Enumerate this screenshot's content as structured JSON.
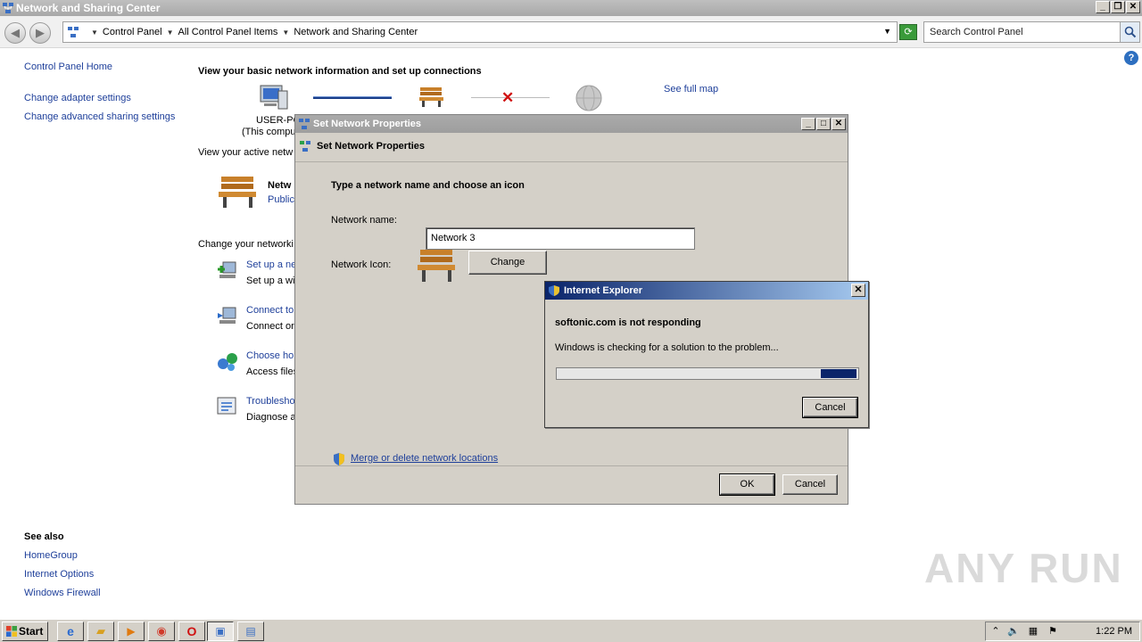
{
  "window": {
    "title": "Network and Sharing Center"
  },
  "addressbar": {
    "crumbs": [
      "Control Panel",
      "All Control Panel Items",
      "Network and Sharing Center"
    ],
    "search_placeholder": "Search Control Panel"
  },
  "sidebar": {
    "links": [
      "Control Panel Home",
      "Change adapter settings",
      "Change advanced sharing settings"
    ],
    "see_also_title": "See also",
    "see_also": [
      "HomeGroup",
      "Internet Options",
      "Windows Firewall"
    ]
  },
  "main": {
    "title": "View your basic network information and set up connections",
    "see_full_map": "See full map",
    "computer_name": "USER-PC",
    "computer_sub": "(This compu",
    "active_networks": "View your active netw",
    "network_name": "Netw",
    "network_type": "Public",
    "change_settings": "Change your networki",
    "tasks": [
      {
        "link": "Set up a ne",
        "desc": "Set up a wi"
      },
      {
        "link": "Connect to",
        "desc": "Connect or"
      },
      {
        "link": "Choose hor",
        "desc": "Access files"
      },
      {
        "link": "Troublesho",
        "desc": "Diagnose a"
      }
    ]
  },
  "set_network_dialog": {
    "title": "Set Network Properties",
    "header": "Set Network Properties",
    "instruction": "Type a network name and choose an icon",
    "name_label": "Network name:",
    "name_value": "Network  3",
    "icon_label": "Network Icon:",
    "change_button": "Change",
    "merge_link": "Merge or delete network locations",
    "ok_button": "OK",
    "cancel_button": "Cancel"
  },
  "ie_dialog": {
    "title": "Internet Explorer",
    "message": "softonic.com is not responding",
    "status": "Windows is checking for a solution to the problem...",
    "cancel_button": "Cancel",
    "progress_fraction": 0.12
  },
  "taskbar": {
    "start_label": "Start",
    "clock": "1:22 PM"
  },
  "watermark": "ANY RUN",
  "colors": {
    "link": "#1e3f9a",
    "ie_title": "#0a246a",
    "progress": "#0a246a"
  }
}
